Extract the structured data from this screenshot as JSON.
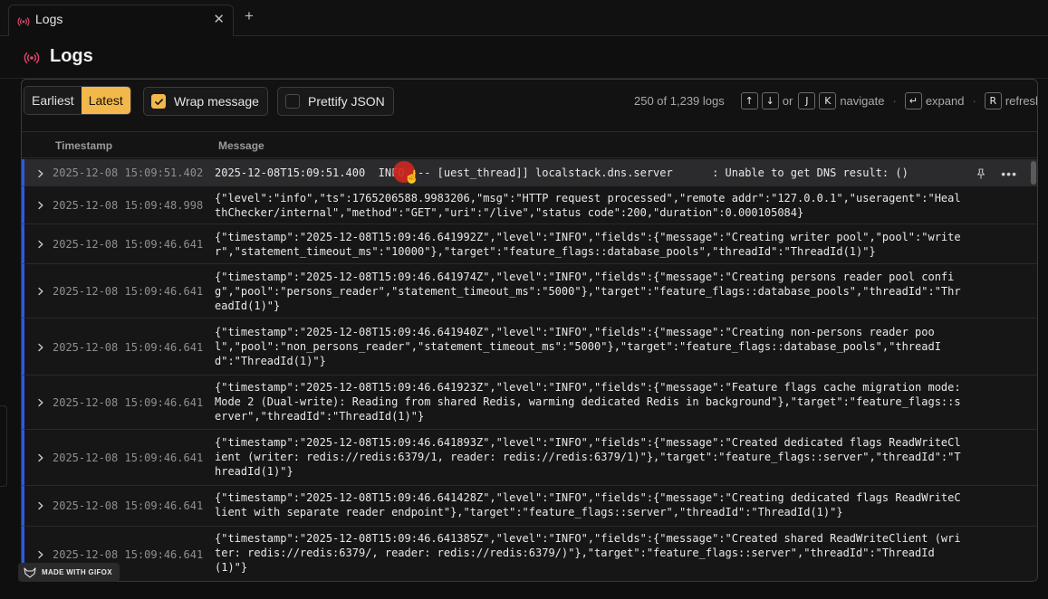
{
  "tab": {
    "title": "Logs",
    "close": "✕",
    "add": "+"
  },
  "header": {
    "title": "Logs"
  },
  "toolbar": {
    "earliest": "Earliest",
    "latest": "Latest",
    "wrap_message": "Wrap message",
    "prettify_json": "Prettify JSON",
    "count": "250 of 1,239 logs",
    "keys": {
      "up": "↑",
      "down": "↓",
      "or": "or",
      "j": "J",
      "k": "K",
      "navigate": "navigate",
      "enter": "↵",
      "expand": "expand",
      "r": "R",
      "refresh": "refresh"
    }
  },
  "columns": {
    "timestamp": "Timestamp",
    "message": "Message"
  },
  "rows": [
    {
      "ts": "2025-12-08 15:09:51.402",
      "msg": "2025-12-08T15:09:51.400  INFO --- [uest_thread]] localstack.dns.server      : Unable to get DNS result: ()"
    },
    {
      "ts": "2025-12-08 15:09:48.998",
      "msg": "{\"level\":\"info\",\"ts\":1765206588.9983206,\"msg\":\"HTTP request processed\",\"remote addr\":\"127.0.0.1\",\"useragent\":\"HealthChecker/internal\",\"method\":\"GET\",\"uri\":\"/live\",\"status code\":200,\"duration\":0.000105084}"
    },
    {
      "ts": "2025-12-08 15:09:46.641",
      "msg": "{\"timestamp\":\"2025-12-08T15:09:46.641992Z\",\"level\":\"INFO\",\"fields\":{\"message\":\"Creating writer pool\",\"pool\":\"writer\",\"statement_timeout_ms\":\"10000\"},\"target\":\"feature_flags::database_pools\",\"threadId\":\"ThreadId(1)\"}"
    },
    {
      "ts": "2025-12-08 15:09:46.641",
      "msg": "{\"timestamp\":\"2025-12-08T15:09:46.641974Z\",\"level\":\"INFO\",\"fields\":{\"message\":\"Creating persons reader pool config\",\"pool\":\"persons_reader\",\"statement_timeout_ms\":\"5000\"},\"target\":\"feature_flags::database_pools\",\"threadId\":\"ThreadId(1)\"}"
    },
    {
      "ts": "2025-12-08 15:09:46.641",
      "msg": "{\"timestamp\":\"2025-12-08T15:09:46.641940Z\",\"level\":\"INFO\",\"fields\":{\"message\":\"Creating non-persons reader pool\",\"pool\":\"non_persons_reader\",\"statement_timeout_ms\":\"5000\"},\"target\":\"feature_flags::database_pools\",\"threadId\":\"ThreadId(1)\"}"
    },
    {
      "ts": "2025-12-08 15:09:46.641",
      "msg": "{\"timestamp\":\"2025-12-08T15:09:46.641923Z\",\"level\":\"INFO\",\"fields\":{\"message\":\"Feature flags cache migration mode: Mode 2 (Dual-write): Reading from shared Redis, warming dedicated Redis in background\"},\"target\":\"feature_flags::server\",\"threadId\":\"ThreadId(1)\"}"
    },
    {
      "ts": "2025-12-08 15:09:46.641",
      "msg": "{\"timestamp\":\"2025-12-08T15:09:46.641893Z\",\"level\":\"INFO\",\"fields\":{\"message\":\"Created dedicated flags ReadWriteClient (writer: redis://redis:6379/1, reader: redis://redis:6379/1)\"},\"target\":\"feature_flags::server\",\"threadId\":\"ThreadId(1)\"}"
    },
    {
      "ts": "2025-12-08 15:09:46.641",
      "msg": "{\"timestamp\":\"2025-12-08T15:09:46.641428Z\",\"level\":\"INFO\",\"fields\":{\"message\":\"Creating dedicated flags ReadWriteClient with separate reader endpoint\"},\"target\":\"feature_flags::server\",\"threadId\":\"ThreadId(1)\"}"
    },
    {
      "ts": "2025-12-08 15:09:46.641",
      "msg": "{\"timestamp\":\"2025-12-08T15:09:46.641385Z\",\"level\":\"INFO\",\"fields\":{\"message\":\"Created shared ReadWriteClient (writer: redis://redis:6379/, reader: redis://redis:6379/)\"},\"target\":\"feature_flags::server\",\"threadId\":\"ThreadId(1)\"}"
    }
  ],
  "badge": {
    "label": "MADE WITH GIFOX"
  },
  "icons": {
    "logs": "broadcast-icon",
    "pin": "pin-icon",
    "more": "more-icon",
    "chevron": "chevron-right-icon"
  },
  "colors": {
    "accent": "#f2b84b",
    "row_border": "#2f5bd8",
    "logs_icon": "#e0466a"
  }
}
